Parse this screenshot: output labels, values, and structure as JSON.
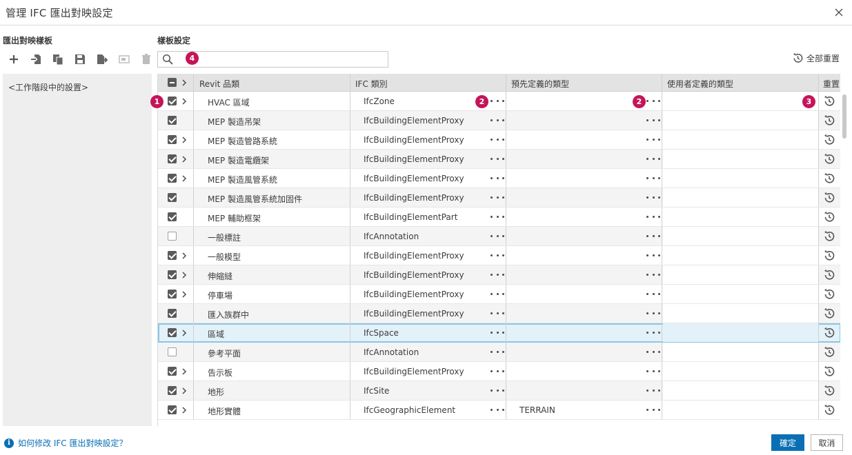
{
  "window": {
    "title": "管理 IFC 匯出對映設定"
  },
  "left": {
    "header": "匯出對映樣板",
    "toolbar": [
      "add-icon",
      "import-icon",
      "duplicate-icon",
      "save-icon",
      "export-icon",
      "rename-icon",
      "delete-icon"
    ],
    "items": [
      "<工作階段中的設置>"
    ]
  },
  "right": {
    "header": "樣板設定",
    "search": {
      "value": "",
      "placeholder": ""
    },
    "reset_all": "全部重置",
    "columns": {
      "revit": "Revit 品類",
      "ifc": "IFC 類別",
      "predef": "預先定義的類型",
      "user": "使用者定義的類型",
      "reset": "重置"
    }
  },
  "badges": {
    "b1": "1",
    "b2": "2",
    "b3": "2",
    "b4": "3",
    "b5": "4"
  },
  "rows": [
    {
      "checked": true,
      "expand": true,
      "revit": "HVAC 區域",
      "ifc": "IfcZone",
      "predef": "",
      "user": ""
    },
    {
      "checked": true,
      "expand": false,
      "revit": "MEP 製造吊架",
      "ifc": "IfcBuildingElementProxy",
      "predef": "",
      "user": ""
    },
    {
      "checked": true,
      "expand": true,
      "revit": "MEP 製造管路系統",
      "ifc": "IfcBuildingElementProxy",
      "predef": "",
      "user": ""
    },
    {
      "checked": true,
      "expand": true,
      "revit": "MEP 製造電纜架",
      "ifc": "IfcBuildingElementProxy",
      "predef": "",
      "user": ""
    },
    {
      "checked": true,
      "expand": true,
      "revit": "MEP 製造風管系統",
      "ifc": "IfcBuildingElementProxy",
      "predef": "",
      "user": ""
    },
    {
      "checked": true,
      "expand": false,
      "revit": "MEP 製造風管系統加固件",
      "ifc": "IfcBuildingElementProxy",
      "predef": "",
      "user": ""
    },
    {
      "checked": true,
      "expand": false,
      "revit": "MEP 輔助框架",
      "ifc": "IfcBuildingElementPart",
      "predef": "",
      "user": ""
    },
    {
      "checked": false,
      "expand": false,
      "revit": "一般標註",
      "ifc": "IfcAnnotation",
      "predef": "",
      "user": ""
    },
    {
      "checked": true,
      "expand": true,
      "revit": "一般模型",
      "ifc": "IfcBuildingElementProxy",
      "predef": "",
      "user": ""
    },
    {
      "checked": true,
      "expand": true,
      "revit": "伸縮縫",
      "ifc": "IfcBuildingElementProxy",
      "predef": "",
      "user": ""
    },
    {
      "checked": true,
      "expand": true,
      "revit": "停車場",
      "ifc": "IfcBuildingElementProxy",
      "predef": "",
      "user": ""
    },
    {
      "checked": true,
      "expand": false,
      "revit": "匯入族群中",
      "ifc": "IfcBuildingElementProxy",
      "predef": "",
      "user": ""
    },
    {
      "checked": true,
      "expand": true,
      "revit": "區域",
      "ifc": "IfcSpace",
      "predef": "",
      "user": "",
      "selected": true
    },
    {
      "checked": false,
      "expand": false,
      "revit": "參考平面",
      "ifc": "IfcAnnotation",
      "predef": "",
      "user": ""
    },
    {
      "checked": true,
      "expand": true,
      "revit": "告示板",
      "ifc": "IfcBuildingElementProxy",
      "predef": "",
      "user": ""
    },
    {
      "checked": true,
      "expand": true,
      "revit": "地形",
      "ifc": "IfcSite",
      "predef": "",
      "user": ""
    },
    {
      "checked": true,
      "expand": true,
      "revit": "地形實體",
      "ifc": "IfcGeographicElement",
      "predef": "TERRAIN",
      "user": ""
    }
  ],
  "footer": {
    "help_link": "如何修改 IFC 匯出對映設定？",
    "ok": "確定",
    "cancel": "取消"
  }
}
